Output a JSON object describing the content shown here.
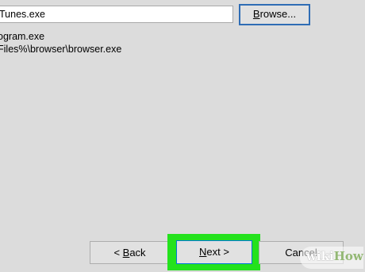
{
  "form": {
    "path_value": "Tunes.exe",
    "browse_label": "Browse...",
    "browse_mnemonic": "B",
    "browse_rest": "rowse...",
    "hint_line_1": "ogram.exe",
    "hint_line_2": "Files%\\browser\\browser.exe"
  },
  "footer": {
    "back_label": "< Back",
    "back_prefix": "< ",
    "back_mnemonic": "B",
    "back_rest": "ack",
    "next_label": "Next >",
    "next_mnemonic": "N",
    "next_rest": "ext >",
    "cancel_label": "Cancel"
  },
  "watermark": {
    "text": "wikiHow",
    "part_1": "wiki",
    "part_2": "How"
  },
  "colors": {
    "dialog_background": "#dcdcdc",
    "highlight": "#24e21d",
    "focus_border": "#2f6db5"
  }
}
